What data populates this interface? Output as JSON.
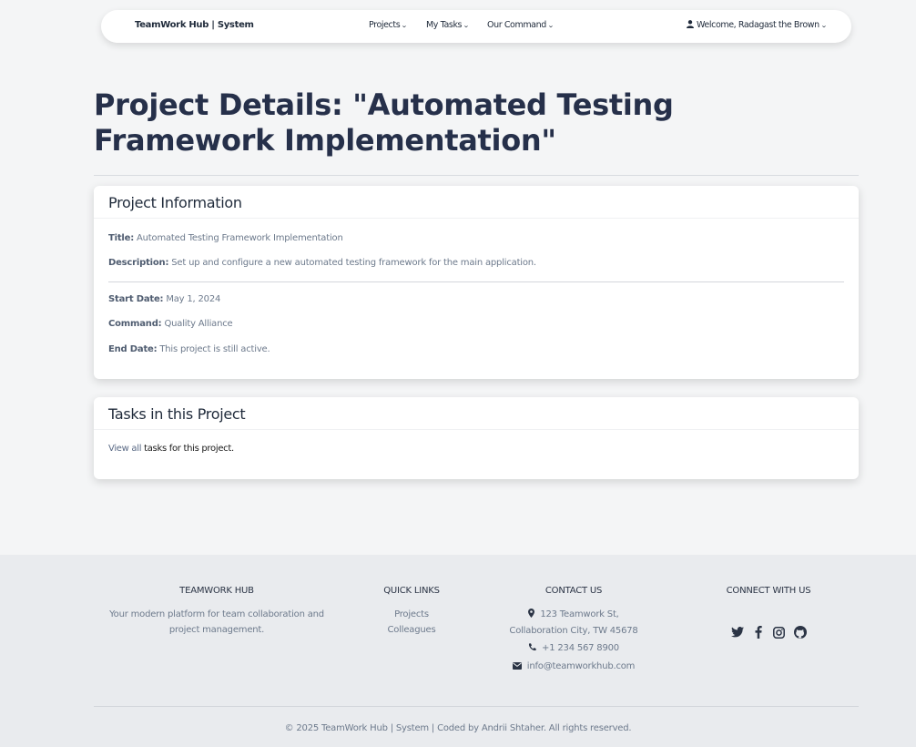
{
  "nav": {
    "brand": "TeamWork Hub | System",
    "items": [
      {
        "label": "Projects"
      },
      {
        "label": "My Tasks"
      },
      {
        "label": "Our Command"
      }
    ],
    "user": "Welcome, Radagast the Brown"
  },
  "page": {
    "title": "Project Details: \"Automated Testing Framework Implementation\""
  },
  "project_info": {
    "header": "Project Information",
    "fields": [
      {
        "label": "Title:",
        "value": "Automated Testing Framework Implementation"
      },
      {
        "label": "Description:",
        "value": "Set up and configure a new automated testing framework for the main application."
      },
      {
        "label": "Start Date:",
        "value": "May 1, 2024"
      },
      {
        "label": "Command:",
        "value": "Quality Alliance"
      },
      {
        "label": "End Date:",
        "value": "This project is still active."
      }
    ]
  },
  "tasks": {
    "header": "Tasks in this Project",
    "link": "View all",
    "text": "tasks for this project."
  },
  "footer": {
    "about_heading": "TEAMWORK HUB",
    "about_text": "Your modern platform for team collaboration and project management.",
    "links_heading": "QUICK LINKS",
    "links": [
      "Projects",
      "Colleagues"
    ],
    "contact_heading": "CONTACT US",
    "address_line1": "123 Teamwork St,",
    "address_line2": "Collaboration City, TW 45678",
    "phone": "+1 234 567 8900",
    "email": "info@teamworkhub.com",
    "social_heading": "CONNECT WITH US",
    "socials": [
      "twitter-icon",
      "facebook-icon",
      "instagram-icon",
      "github-icon"
    ],
    "copyright": "© 2025 TeamWork Hub | System | Coded by Andrii Shtaher. All rights reserved."
  },
  "colors": {
    "background": "#f4f5f6",
    "footer": "#e9ebee",
    "title": "#26304a",
    "muted": "#6d7a8c"
  }
}
